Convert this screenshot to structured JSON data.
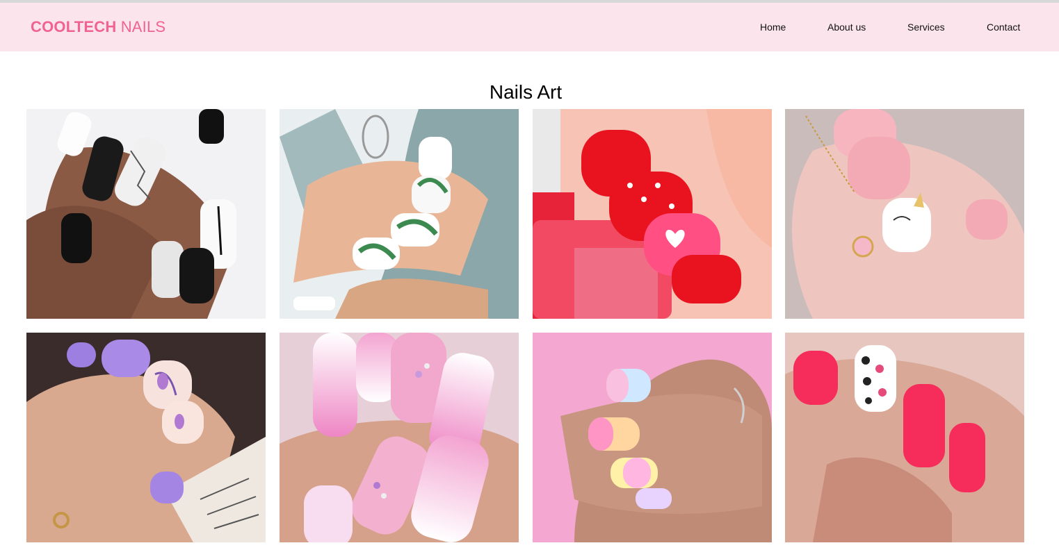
{
  "brand": {
    "part1": "COOLTECH",
    "part2": " NAILS",
    "color": "#f06292"
  },
  "nav": {
    "home": "Home",
    "about": "About us",
    "services": "Services",
    "contact": "Contact"
  },
  "section": {
    "title": "Nails Art"
  },
  "gallery": [
    {
      "theme": "black-white-marble"
    },
    {
      "theme": "green-leaf"
    },
    {
      "theme": "red-polka-dot"
    },
    {
      "theme": "pink-unicorn"
    },
    {
      "theme": "lavender-floral"
    },
    {
      "theme": "pink-ombre-rhinestone"
    },
    {
      "theme": "pastel-rainbow"
    },
    {
      "theme": "coral-leopard"
    }
  ],
  "colors": {
    "header_bg": "#fce4ec",
    "accent": "#f06292"
  }
}
